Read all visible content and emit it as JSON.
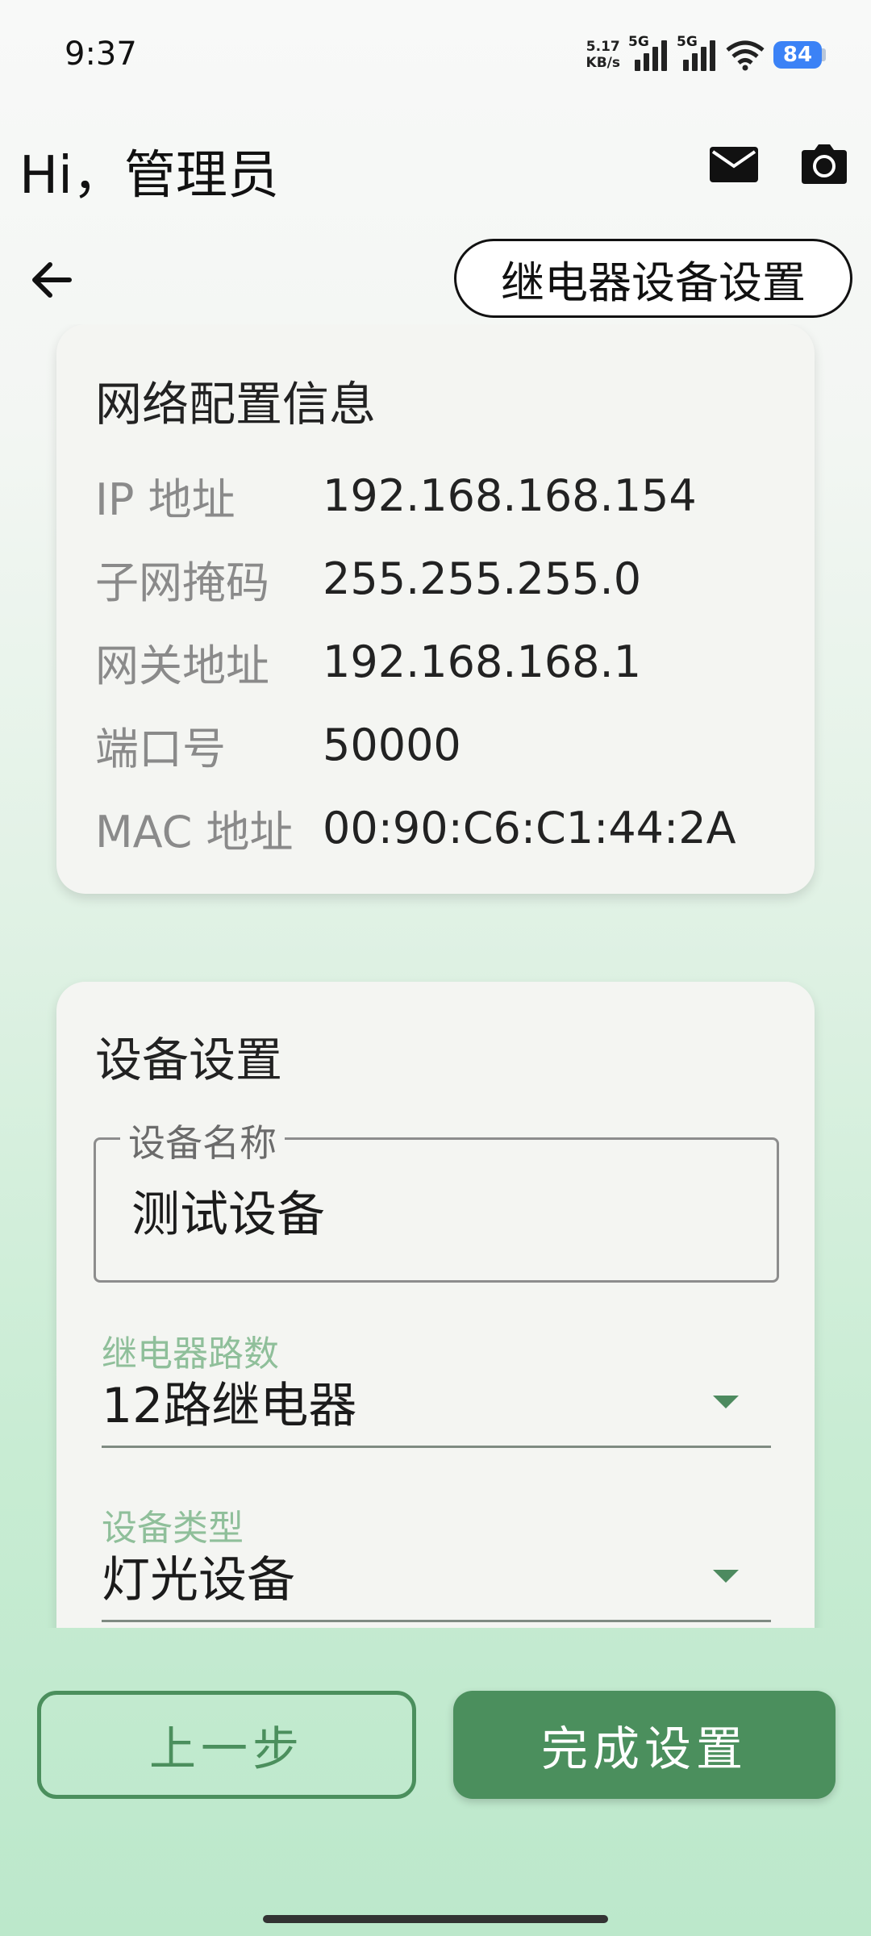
{
  "status_bar": {
    "time": "9:37",
    "net_speed_value": "5.17",
    "net_speed_unit": "KB/s",
    "sim1_label": "5G",
    "sim2_label": "5G",
    "battery": "84"
  },
  "header": {
    "greeting": "Hi，管理员"
  },
  "title_bar": {
    "title": "继电器设备设置"
  },
  "network_card": {
    "title": "网络配置信息",
    "rows": [
      {
        "label": "IP 地址",
        "value": "192.168.168.154"
      },
      {
        "label": "子网掩码",
        "value": "255.255.255.0"
      },
      {
        "label": "网关地址",
        "value": "192.168.168.1"
      },
      {
        "label": "端口号",
        "value": "50000"
      },
      {
        "label": "MAC 地址",
        "value": "00:90:C6:C1:44:2A"
      }
    ]
  },
  "device_card": {
    "title": "设备设置",
    "name_field": {
      "label": "设备名称",
      "value": "测试设备"
    },
    "relay_count": {
      "label": "继电器路数",
      "value": "12路继电器"
    },
    "device_type": {
      "label": "设备类型",
      "value": "灯光设备"
    }
  },
  "buttons": {
    "prev": "上一步",
    "done": "完成设置"
  },
  "colors": {
    "accent": "#4b8f5d",
    "label_accent": "#8fbf9a",
    "battery": "#3b82f6"
  }
}
